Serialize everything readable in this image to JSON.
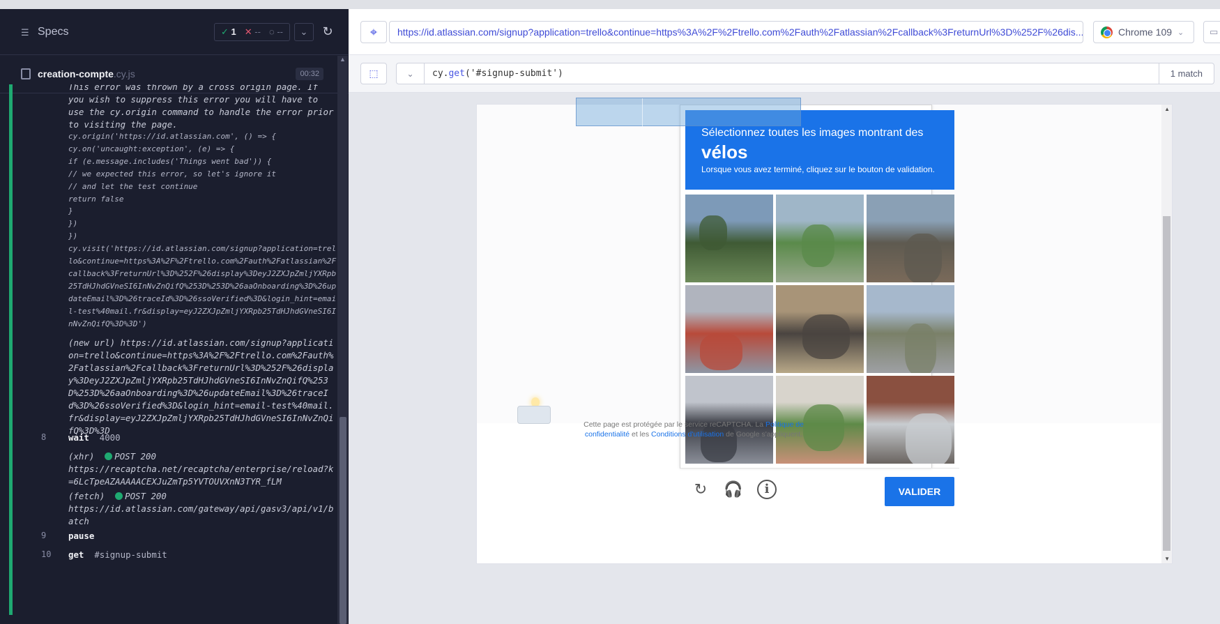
{
  "reporter": {
    "specs_label": "Specs",
    "stats": {
      "passed": "1",
      "failed": "--",
      "pending": "--"
    },
    "spec": {
      "name": "creation-compte",
      "ext": ".cy.js",
      "duration": "00:32"
    },
    "error_text": "This error was thrown by a cross origin page. If you wish to suppress this error you will have to use the cy.origin command to handle the error prior to visiting the page.",
    "code_snippet": "cy.origin('https://id.atlassian.com', () => {\ncy.on('uncaught:exception', (e) => {\nif (e.message.includes('Things went bad')) {\n// we expected this error, so let's ignore it\n// and let the test continue\nreturn false\n}\n})\n})\ncy.visit('https://id.atlassian.com/signup?application=trello&continue=https%3A%2F%2Ftrello.com%2Fauth%2Fatlassian%2Fcallback%3FreturnUrl%3D%252F%26display%3DeyJ2ZXJpZmljYXRpb25TdHJhdGVneSI6InNvZnQifQ%253D%253D%26aaOnboarding%3D%26updateEmail%3D%26traceId%3D%26ssoVerified%3D&login_hint=email-test%40mail.fr&display=eyJ2ZXJpZmljYXRpb25TdHJhdGVneSI6InNvZnQifQ%3D%3D')",
    "new_url_label": "(new url)",
    "new_url": "https://id.atlassian.com/signup?application=trello&continue=https%3A%2F%2Ftrello.com%2Fauth%2Fatlassian%2Fcallback%3FreturnUrl%3D%252F%26display%3DeyJ2ZXJpZmljYXRpb25TdHJhdGVneSI6InNvZnQifQ%253D%253D%26aaOnboarding%3D%26updateEmail%3D%26traceId%3D%26ssoVerified%3D&login_hint=email-test%40mail.fr&display=eyJ2ZXJpZmljYXRpb25TdHJhdGVneSI6InNvZnQifQ%3D%3D",
    "commands": [
      {
        "num": "8",
        "name": "wait",
        "arg": "4000"
      },
      {
        "num": "9",
        "name": "pause",
        "arg": ""
      },
      {
        "num": "10",
        "name": "get",
        "arg": "#signup-submit"
      }
    ],
    "xhr": {
      "label": "(xhr)",
      "method": "POST 200",
      "url": "https://recaptcha.net/recaptcha/enterprise/reload?k=6LcTpeAZAAAAACEXJuZmTp5YVTOUVXnN3TYR_fLM"
    },
    "fetch": {
      "label": "(fetch)",
      "method": "POST 200",
      "url": "https://id.atlassian.com/gateway/api/gasv3/api/v1/batch"
    }
  },
  "aut": {
    "url": "https://id.atlassian.com/signup?application=trello&continue=https%3A%2F%2Ftrello.com%2Fauth%2Fatlassian%2Fcallback%3FreturnUrl%3D%252F%26dis...",
    "browser": "Chrome 109",
    "selector": {
      "prefix": "cy.",
      "method": "get",
      "open": "('",
      "value": "#signup-submit",
      "close": "')"
    },
    "match": "1 match"
  },
  "captcha": {
    "line1": "Sélectionnez toutes les images montrant des",
    "target": "vélos",
    "line3": "Lorsque vous avez terminé, cliquez sur le bouton de validation.",
    "submit_label": "VALIDER",
    "notice_pre": "Cette page est protégée par le service reCAPTCHA. La ",
    "privacy_link": "Politique de confidentialité",
    "notice_mid": " et les ",
    "terms_link": "Conditions d'utilisation",
    "notice_post": " de Google s'appliquent.",
    "tiles": [
      {
        "colors": [
          "#7d9ab8",
          "#3f5a34",
          "#6d8a5a"
        ]
      },
      {
        "colors": [
          "#9fb6c8",
          "#5a8a4a",
          "#98a88c"
        ]
      },
      {
        "colors": [
          "#8aa0b5",
          "#5e5a50",
          "#7a6a5a"
        ]
      },
      {
        "colors": [
          "#b0b4be",
          "#b84a3a",
          "#8e96a4"
        ]
      },
      {
        "colors": [
          "#a89478",
          "#4a4440",
          "#b8a888"
        ]
      },
      {
        "colors": [
          "#a6b8cc",
          "#7a8068",
          "#9ea0a4"
        ]
      },
      {
        "colors": [
          "#c0c4cc",
          "#3a3c44",
          "#8a8e98"
        ]
      },
      {
        "colors": [
          "#d8d4cc",
          "#5e8a48",
          "#c89078"
        ]
      },
      {
        "colors": [
          "#8a5040",
          "#c8ccd0",
          "#6a6460"
        ]
      }
    ]
  }
}
